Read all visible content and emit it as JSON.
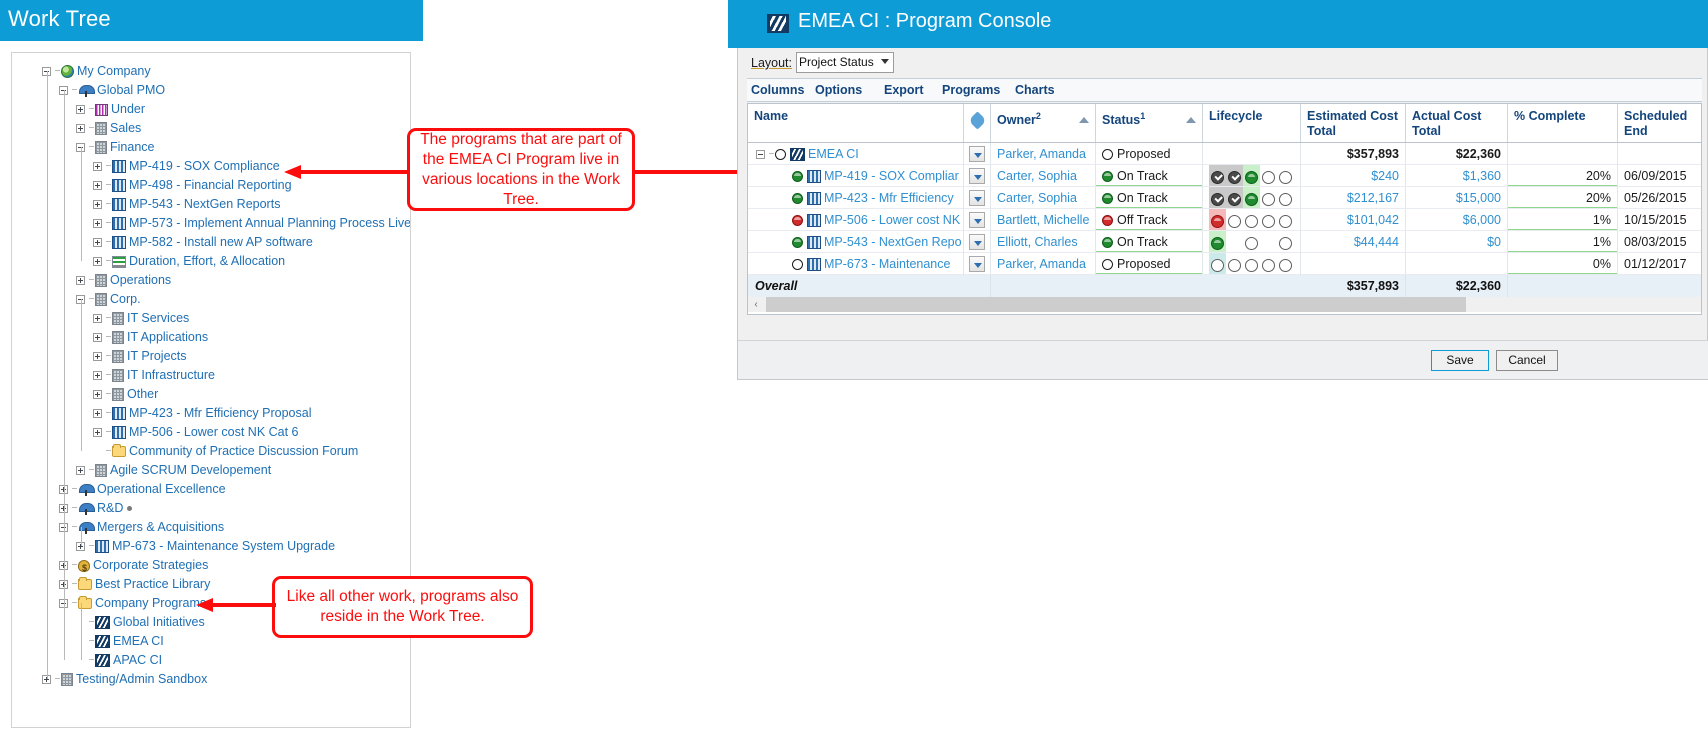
{
  "worktree": {
    "title": "Work Tree",
    "nodes": [
      {
        "label": "My Company",
        "icon": "globe-icon",
        "depth": 0,
        "expander": "minus"
      },
      {
        "label": "Global PMO",
        "icon": "umbrella-icon",
        "depth": 1,
        "expander": "minus"
      },
      {
        "label": "Under",
        "icon": "barcode-icon",
        "depth": 2,
        "expander": "plus"
      },
      {
        "label": "Sales",
        "icon": "building-icon",
        "depth": 2,
        "expander": "plus"
      },
      {
        "label": "Finance",
        "icon": "building-icon",
        "depth": 2,
        "expander": "minus"
      },
      {
        "label": "MP-419 - SOX Compliance",
        "icon": "project-icon",
        "depth": 3,
        "expander": "plus"
      },
      {
        "label": "MP-498 - Financial Reporting",
        "icon": "project-icon",
        "depth": 3,
        "expander": "plus"
      },
      {
        "label": "MP-543 - NextGen Reports",
        "icon": "project-icon",
        "depth": 3,
        "expander": "plus"
      },
      {
        "label": "MP-573 - Implement Annual Planning Process Live",
        "icon": "project-icon",
        "depth": 3,
        "expander": "plus"
      },
      {
        "label": "MP-582 - Install new AP software",
        "icon": "project-icon",
        "depth": 3,
        "expander": "plus"
      },
      {
        "label": "Duration, Effort, & Allocation",
        "icon": "allocation-icon",
        "depth": 3,
        "expander": "plus"
      },
      {
        "label": "Operations",
        "icon": "building-icon",
        "depth": 2,
        "expander": "plus"
      },
      {
        "label": "Corp.",
        "icon": "building-icon",
        "depth": 2,
        "expander": "minus"
      },
      {
        "label": "IT Services",
        "icon": "building-icon",
        "depth": 3,
        "expander": "plus"
      },
      {
        "label": "IT Applications",
        "icon": "building-icon",
        "depth": 3,
        "expander": "plus"
      },
      {
        "label": "IT Projects",
        "icon": "building-icon",
        "depth": 3,
        "expander": "plus"
      },
      {
        "label": "IT Infrastructure",
        "icon": "building-icon",
        "depth": 3,
        "expander": "plus"
      },
      {
        "label": "Other",
        "icon": "building-icon",
        "depth": 3,
        "expander": "plus"
      },
      {
        "label": "MP-423 - Mfr Efficiency Proposal",
        "icon": "project-icon",
        "depth": 3,
        "expander": "plus"
      },
      {
        "label": "MP-506 - Lower cost NK Cat 6",
        "icon": "project-icon",
        "depth": 3,
        "expander": "plus"
      },
      {
        "label": "Community of Practice Discussion Forum",
        "icon": "folder-icon",
        "depth": 3,
        "expander": "none"
      },
      {
        "label": "Agile SCRUM Developement",
        "icon": "building-icon",
        "depth": 2,
        "expander": "plus"
      },
      {
        "label": "Operational Excellence",
        "icon": "umbrella-icon",
        "depth": 1,
        "expander": "plus"
      },
      {
        "label": "R&D",
        "icon": "umbrella-icon",
        "depth": 1,
        "expander": "plus",
        "dot": true
      },
      {
        "label": "Mergers & Acquisitions",
        "icon": "umbrella-icon",
        "depth": 1,
        "expander": "minus"
      },
      {
        "label": "MP-673 - Maintenance System Upgrade",
        "icon": "project-icon",
        "depth": 2,
        "expander": "plus"
      },
      {
        "label": "Corporate Strategies",
        "icon": "money-icon",
        "depth": 1,
        "expander": "plus"
      },
      {
        "label": "Best Practice Library",
        "icon": "folder-icon",
        "depth": 1,
        "expander": "plus"
      },
      {
        "label": "Company Programs",
        "icon": "folder-icon",
        "depth": 1,
        "expander": "minus"
      },
      {
        "label": "Global Initiatives",
        "icon": "program-icon",
        "depth": 2,
        "expander": "none"
      },
      {
        "label": "EMEA CI",
        "icon": "program-icon",
        "depth": 2,
        "expander": "none"
      },
      {
        "label": "APAC CI",
        "icon": "program-icon",
        "depth": 2,
        "expander": "none"
      },
      {
        "label": "Testing/Admin Sandbox",
        "icon": "building-icon",
        "depth": 0,
        "expander": "plus"
      }
    ]
  },
  "callouts": {
    "top": "The programs that are part of the EMEA CI Program live in various locations in the Work Tree.",
    "bottom": "Like all other work, programs also reside in the Work Tree."
  },
  "console": {
    "title": "EMEA CI : Program Console",
    "logo_icon": "program-logo-icon",
    "layout": {
      "label": "Layout:",
      "selected": "Project Status",
      "options": [
        "Project Status"
      ]
    },
    "menu": [
      "Columns",
      "Options",
      "Export",
      "Programs",
      "Charts"
    ],
    "grid": {
      "columns": [
        {
          "label": "Name",
          "sort": ""
        },
        {
          "label": "",
          "icon": "wrench-icon"
        },
        {
          "label": "Owner",
          "sup": "2",
          "sort": "asc"
        },
        {
          "label": "Status",
          "sup": "1",
          "sort": "asc"
        },
        {
          "label": "Lifecycle"
        },
        {
          "label": "Estimated Cost Total"
        },
        {
          "label": "Actual Cost Total"
        },
        {
          "label": "% Complete"
        },
        {
          "label": "Scheduled End"
        }
      ],
      "rows": [
        {
          "name": "EMEA CI",
          "icon": "program-icon",
          "mark": "open",
          "indent": 0,
          "expander": "minus",
          "owner": "Parker, Amanda",
          "status": "Proposed",
          "status_mark": "open",
          "lifecycle": [],
          "est_cost": "$357,893",
          "act_cost": "$22,360",
          "pct": "",
          "sched_end": "",
          "bold": true
        },
        {
          "name": "MP-419 - SOX Compliar",
          "icon": "project-icon",
          "mark": "green",
          "indent": 1,
          "expander": "none",
          "owner": "Carter, Sophia",
          "status": "On Track",
          "status_mark": "green",
          "lifecycle": [
            "check-gray",
            "check-gray",
            "green-hl",
            "open",
            "open"
          ],
          "est_cost": "$240",
          "act_cost": "$1,360",
          "pct": "20%",
          "sched_end": "06/09/2015"
        },
        {
          "name": "MP-423 - Mfr Efficiency",
          "icon": "project-icon",
          "mark": "green",
          "indent": 1,
          "expander": "none",
          "owner": "Carter, Sophia",
          "status": "On Track",
          "status_mark": "green",
          "lifecycle": [
            "check-gray",
            "check-gray",
            "green-hl",
            "open",
            "open"
          ],
          "est_cost": "$212,167",
          "act_cost": "$15,000",
          "pct": "20%",
          "sched_end": "05/26/2015"
        },
        {
          "name": "MP-506 - Lower cost NK",
          "icon": "project-icon",
          "mark": "red",
          "indent": 1,
          "expander": "none",
          "owner": "Bartlett, Michelle",
          "status": "Off Track",
          "status_mark": "red",
          "lifecycle": [
            "red-hl",
            "open",
            "open",
            "open",
            "open"
          ],
          "est_cost": "$101,042",
          "act_cost": "$6,000",
          "pct": "1%",
          "sched_end": "10/15/2015"
        },
        {
          "name": "MP-543 - NextGen Repo",
          "icon": "project-icon",
          "mark": "green",
          "indent": 1,
          "expander": "none",
          "owner": "Elliott, Charles",
          "status": "On Track",
          "status_mark": "green",
          "lifecycle": [
            "green-hl",
            "blank",
            "open",
            "blank",
            "open"
          ],
          "est_cost": "$44,444",
          "act_cost": "$0",
          "pct": "1%",
          "sched_end": "08/03/2015"
        },
        {
          "name": "MP-673 - Maintenance ",
          "icon": "project-icon",
          "mark": "open",
          "indent": 1,
          "expander": "none",
          "owner": "Parker, Amanda",
          "status": "Proposed",
          "status_mark": "open",
          "lifecycle": [
            "cyan-hl",
            "open",
            "open",
            "open",
            "open"
          ],
          "est_cost": "",
          "act_cost": "",
          "pct": "0%",
          "sched_end": "01/12/2017"
        }
      ],
      "overall": {
        "label": "Overall",
        "est_cost": "$357,893",
        "act_cost": "$22,360"
      }
    },
    "footer": {
      "save": "Save",
      "cancel": "Cancel"
    },
    "scrollbar": {
      "left_arrow": "‹"
    }
  },
  "colors": {
    "header_blue": "#0e9cd6",
    "link_blue": "#2f8fd0",
    "tree_blue": "#1f6fb4",
    "callout_red": "#fc0d0d",
    "grid_header": "#13457c",
    "status_green": "#1f8a2e",
    "status_red": "#d22b2b"
  }
}
